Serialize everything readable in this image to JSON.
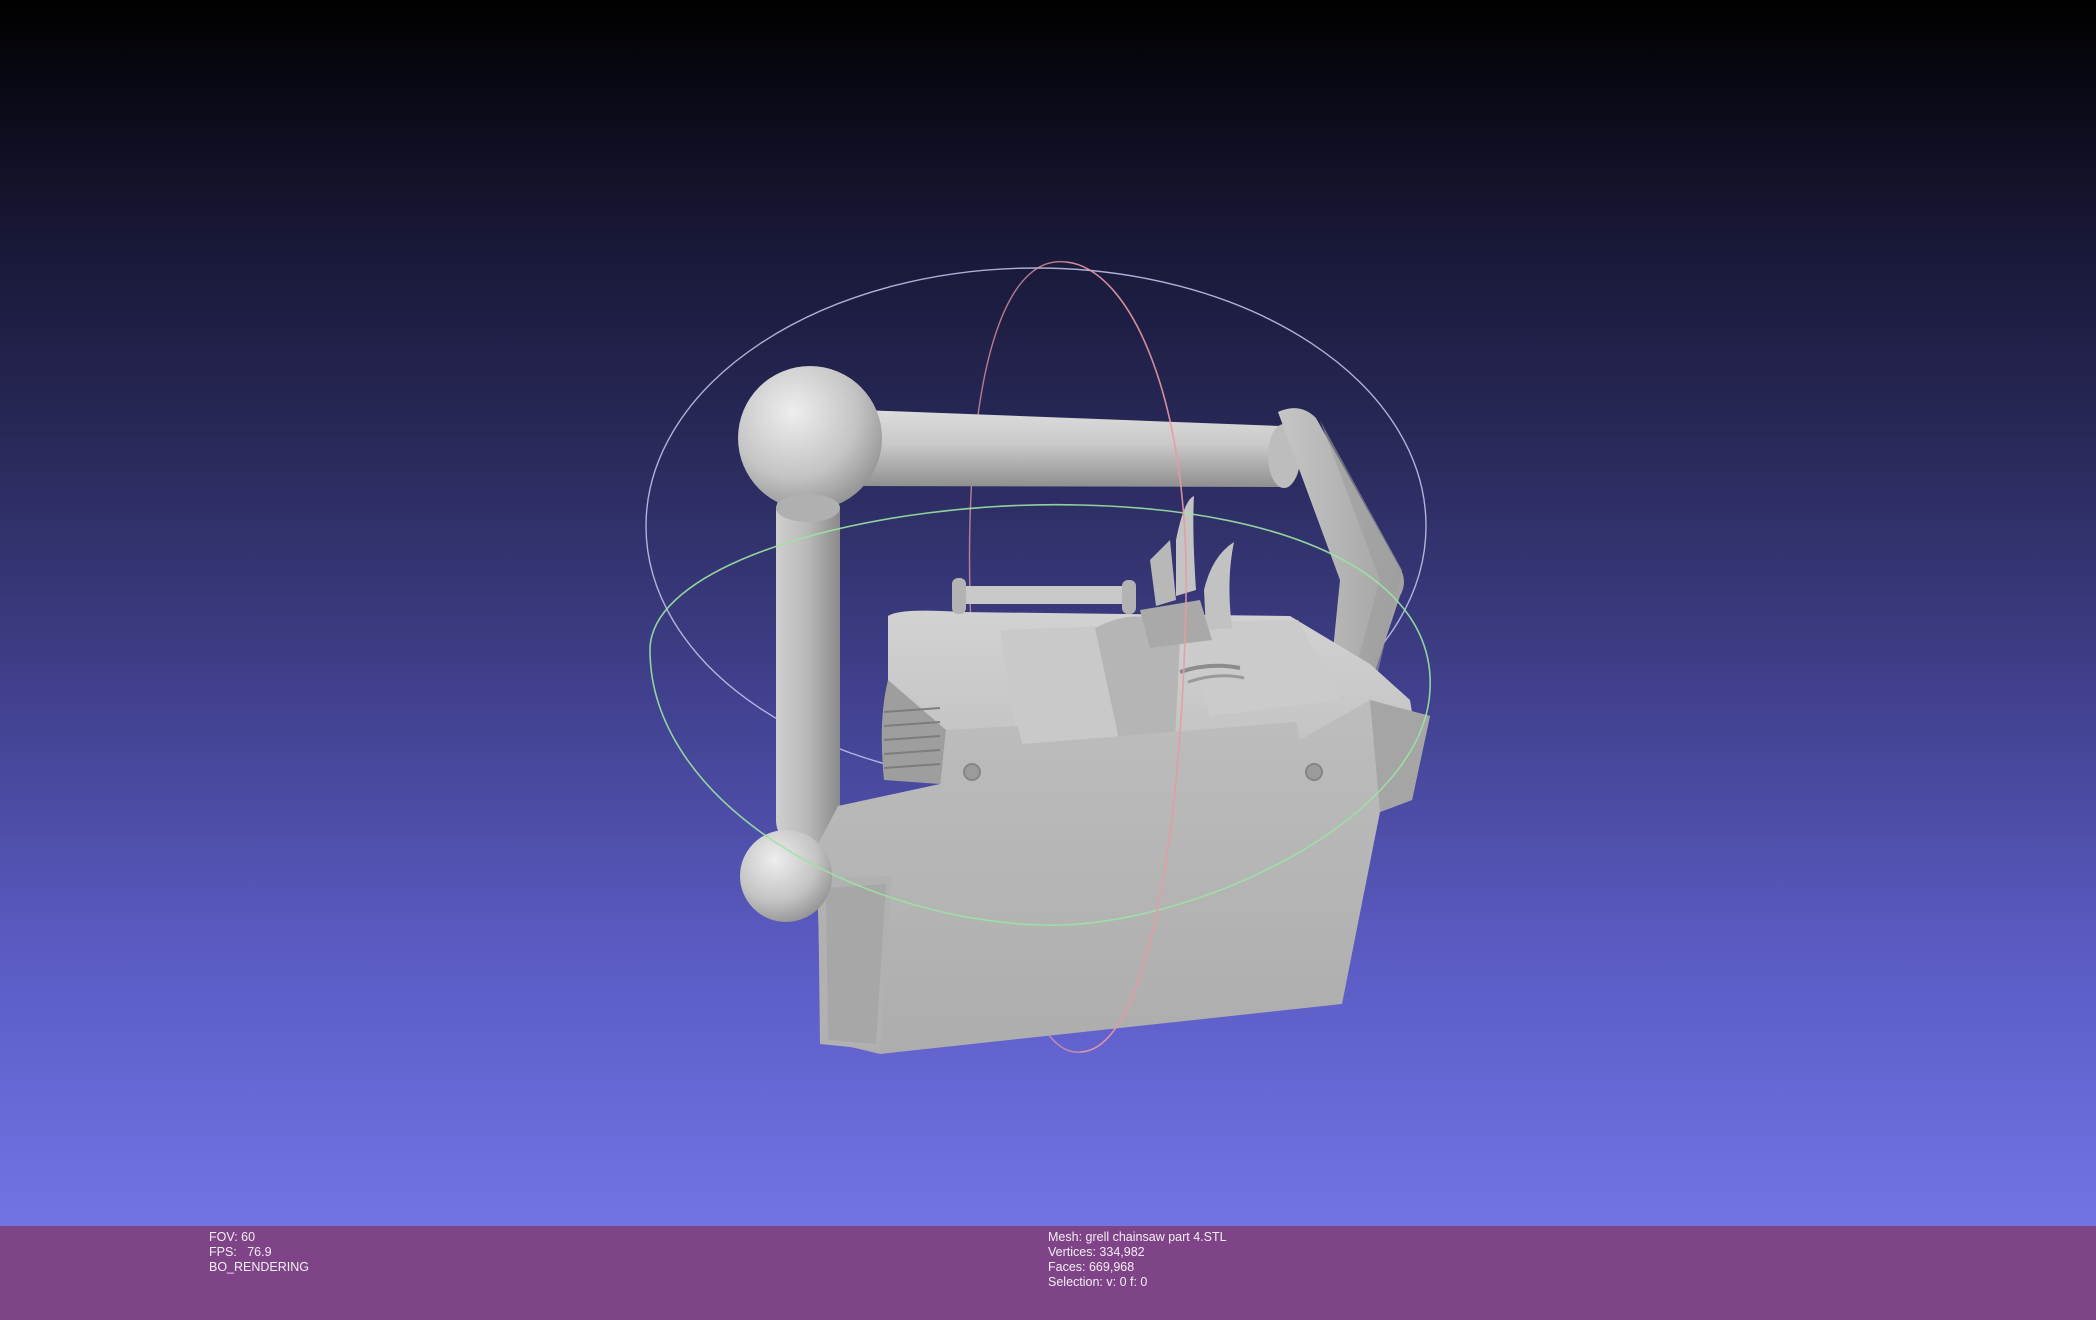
{
  "viewer": {
    "left_info": {
      "fov": "FOV: 60",
      "fps": "FPS:   76.9",
      "mode": "BO_RENDERING"
    },
    "right_info": {
      "mesh": "Mesh: grell chainsaw part 4.STL",
      "vertices": "Vertices: 334,982",
      "faces": "Faces: 669,968",
      "selection": "Selection: v: 0 f: 0"
    },
    "colors": {
      "background_top": "#000000",
      "background_bottom": "#7373e6",
      "status_bar": "#7f4487",
      "mesh": "#b9b9b9",
      "trackball_red": "#e89aa4",
      "trackball_green": "#9be3a3",
      "trackball_blue": "#c9c9ef"
    }
  }
}
